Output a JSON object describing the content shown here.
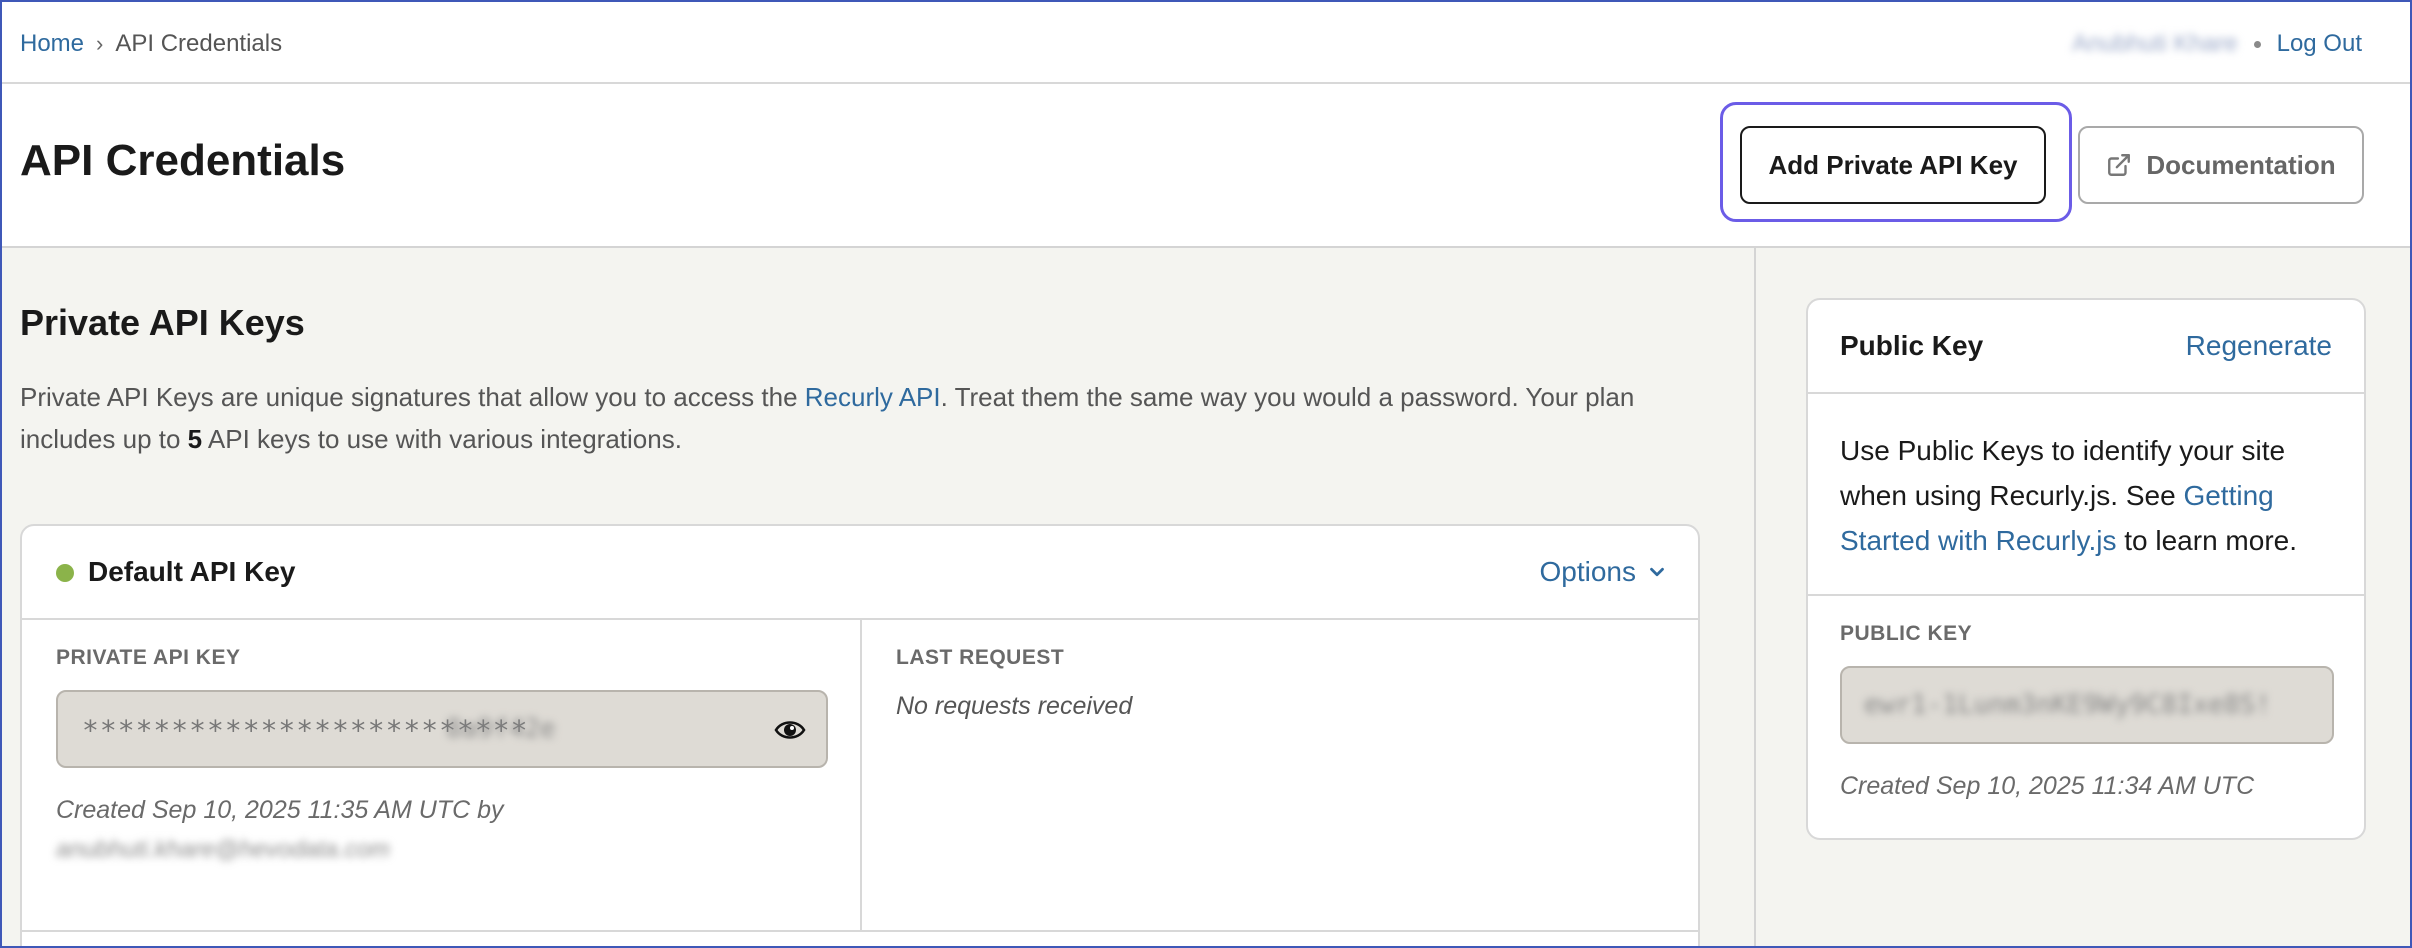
{
  "breadcrumb": {
    "home": "Home",
    "separator": "›",
    "current": "API Credentials"
  },
  "user": {
    "name": "Anubhuti Khare",
    "logout": "Log Out"
  },
  "header": {
    "title": "API Credentials",
    "add_button": "Add Private API Key",
    "docs_button": "Documentation"
  },
  "private_keys": {
    "title": "Private API Keys",
    "desc_before_link": "Private API Keys are unique signatures that allow you to access the ",
    "desc_link": "Recurly API",
    "desc_after_link": ". Treat them the same way you would a password. Your plan includes up to ",
    "desc_count": "5",
    "desc_end": " API keys to use with various integrations.",
    "card": {
      "title": "Default API Key",
      "options": "Options",
      "private_key_label": "PRIVATE API KEY",
      "masked_key": "*************************",
      "key_suffix": "8a9f42e",
      "created": "Created Sep 10, 2025 11:35 AM UTC by",
      "created_by": "anubhuti.khare@hevodata.com",
      "last_request_label": "LAST REQUEST",
      "last_request_value": "No requests received"
    }
  },
  "public_key": {
    "title": "Public Key",
    "regenerate": "Regenerate",
    "desc_before_link": "Use Public Keys to identify your site when using Recurly.js. See ",
    "desc_link": "Getting Started with Recurly.js",
    "desc_after_link": " to learn more.",
    "label": "PUBLIC KEY",
    "value": "ewr1-1Lunm3nKE9Wy9C8Ixe8S!",
    "created": "Created Sep 10, 2025 11:34 AM UTC"
  },
  "colors": {
    "link": "#2f6a9e",
    "focus_ring": "#6b5ce7",
    "status_active": "#8bb34a",
    "page_bg": "#f4f4f0"
  }
}
